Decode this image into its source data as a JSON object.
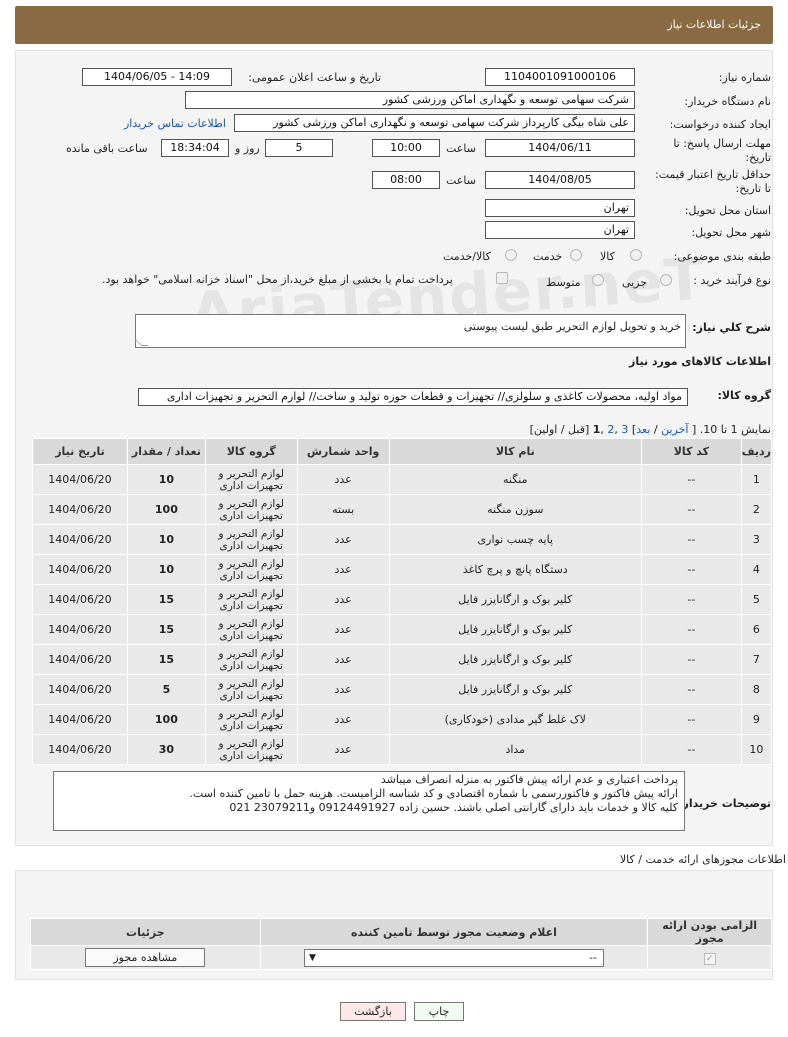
{
  "header": {
    "title": "جزئیات اطلاعات نیاز"
  },
  "form": {
    "need_number_label": "شماره نیاز:",
    "need_number": "1104001091000106",
    "announce_label": "تاریخ و ساعت اعلان عمومی:",
    "announce_value": "1404/06/05 - 14:09",
    "buyer_org_label": "نام دستگاه خریدار:",
    "buyer_org": "شرکت سهامی توسعه و نگهداری اماکن ورزشی کشور",
    "requester_label": "ایجاد کننده درخواست:",
    "requester": "علی شاه بیگی کارپرداز شرکت سهامی توسعه و نگهداری اماکن ورزشی کشور",
    "buyer_contact_link": "اطلاعات تماس خریدار",
    "deadline_label_1": "مهلت ارسال پاسخ: تا",
    "deadline_label_2": "تاریخ:",
    "deadline_date": "1404/06/11",
    "time_label": "ساعت",
    "deadline_time": "10:00",
    "days_value": "5",
    "days_label": "روز و",
    "remaining_time": "18:34:04",
    "remaining_label": "ساعت باقی مانده",
    "min_price_label_1": "حداقل تاریخ اعتبار قیمت:",
    "min_price_label_2": "تا تاریخ:",
    "min_price_date": "1404/08/05",
    "time_label_2": "ساعت",
    "min_price_time": "08:00",
    "province_label": "استان محل تحویل:",
    "province": "تهران",
    "city_label": "شهر محل تحویل:",
    "city": "تهران",
    "category_label": "طبقه بندی موضوعی:",
    "category_options": [
      "کالا",
      "خدمت",
      "کالا/خدمت"
    ],
    "purchase_type_label": "نوع فرآیند خرید :",
    "purchase_options": [
      "جزیی",
      "متوسط"
    ],
    "treasury_text": "پرداخت تمام یا بخشی از مبلغ خرید،از محل \"اسناد خزانه اسلامی\" خواهد بود.",
    "desc_label": "شرح کلي نياز:",
    "desc_value": "خرید و تحویل لوازم التحریر طبق لیست پیوستی",
    "goods_info_title": "اطلاعات کالاهای مورد نیاز",
    "goods_group_label": "گروه کالا:",
    "goods_group_value": "مواد اولیه، محصولات کاغذی و سلولزی// تجهیزات و قطعات حوزه تولید و ساخت// لوازم التحریر و تجهیزات اداری"
  },
  "pagination": {
    "prefix": "نمایش 1 تا 10. [",
    "last": "آخرین",
    "next": "بعد",
    "p3": "3",
    "p2": "2",
    "current": "1",
    "suffix": "[قبل / اولین]"
  },
  "table": {
    "headers": [
      "ردیف",
      "کد کالا",
      "نام کالا",
      "واحد شمارش",
      "گروه کالا",
      "تعداد / مقدار",
      "تاریخ نیاز"
    ],
    "rows": [
      {
        "idx": "1",
        "code": "--",
        "name": "منگنه",
        "unit": "عدد",
        "group": "لوازم التحریر و تجهیزات اداری",
        "qty": "10",
        "date": "1404/06/20"
      },
      {
        "idx": "2",
        "code": "--",
        "name": "سوزن منگنه",
        "unit": "بسته",
        "group": "لوازم التحریر و تجهیزات اداری",
        "qty": "100",
        "date": "1404/06/20"
      },
      {
        "idx": "3",
        "code": "--",
        "name": "پایه چسب نواری",
        "unit": "عدد",
        "group": "لوازم التحریر و تجهیزات اداری",
        "qty": "10",
        "date": "1404/06/20"
      },
      {
        "idx": "4",
        "code": "--",
        "name": "دستگاه پانچ و پرچ کاغذ",
        "unit": "عدد",
        "group": "لوازم التحریر و تجهیزات اداری",
        "qty": "10",
        "date": "1404/06/20"
      },
      {
        "idx": "5",
        "code": "--",
        "name": "کلیر بوک و ارگانایزر فایل",
        "unit": "عدد",
        "group": "لوازم التحریر و تجهیزات اداری",
        "qty": "15",
        "date": "1404/06/20"
      },
      {
        "idx": "6",
        "code": "--",
        "name": "کلیر بوک و ارگانایزر فایل",
        "unit": "عدد",
        "group": "لوازم التحریر و تجهیزات اداری",
        "qty": "15",
        "date": "1404/06/20"
      },
      {
        "idx": "7",
        "code": "--",
        "name": "کلیر بوک و ارگانایزر فایل",
        "unit": "عدد",
        "group": "لوازم التحریر و تجهیزات اداری",
        "qty": "15",
        "date": "1404/06/20"
      },
      {
        "idx": "8",
        "code": "--",
        "name": "کلیر بوک و ارگانایزر فایل",
        "unit": "عدد",
        "group": "لوازم التحریر و تجهیزات اداری",
        "qty": "5",
        "date": "1404/06/20"
      },
      {
        "idx": "9",
        "code": "--",
        "name": "لاک غلط گیر مدادی (خودکاری)",
        "unit": "عدد",
        "group": "لوازم التحریر و تجهیزات اداری",
        "qty": "100",
        "date": "1404/06/20"
      },
      {
        "idx": "10",
        "code": "--",
        "name": "مداد",
        "unit": "عدد",
        "group": "لوازم التحریر و تجهیزات اداری",
        "qty": "30",
        "date": "1404/06/20"
      }
    ]
  },
  "buyer_notes": {
    "label": "توضیحات خریدار:",
    "lines": [
      "پرداخت اعتباری و عدم ارائه پیش فاکتور به منزله انصراف میباشد",
      "ارائه پیش فاکتور و فاکتوررسمی با شماره اقتصادی و کد شناسه الزامیست. هزینه حمل با تامین کننده است.",
      "کلیه کالا و خدمات باید دارای گارانتی اصلی باشند. حسین زاده 09124491927 و23079211 021"
    ]
  },
  "permits": {
    "title": "اطلاعات مجوزهای ارائه خدمت / کالا",
    "headers": [
      "الزامی بودن ارائه مجوز",
      "اعلام وضعیت مجوز توسط تامین کننده",
      "جزئیات"
    ],
    "select_value": "--",
    "view_button": "مشاهده مجوز"
  },
  "actions": {
    "print": "چاپ",
    "back": "بازگشت"
  },
  "watermark": "AriaTender.neT"
}
